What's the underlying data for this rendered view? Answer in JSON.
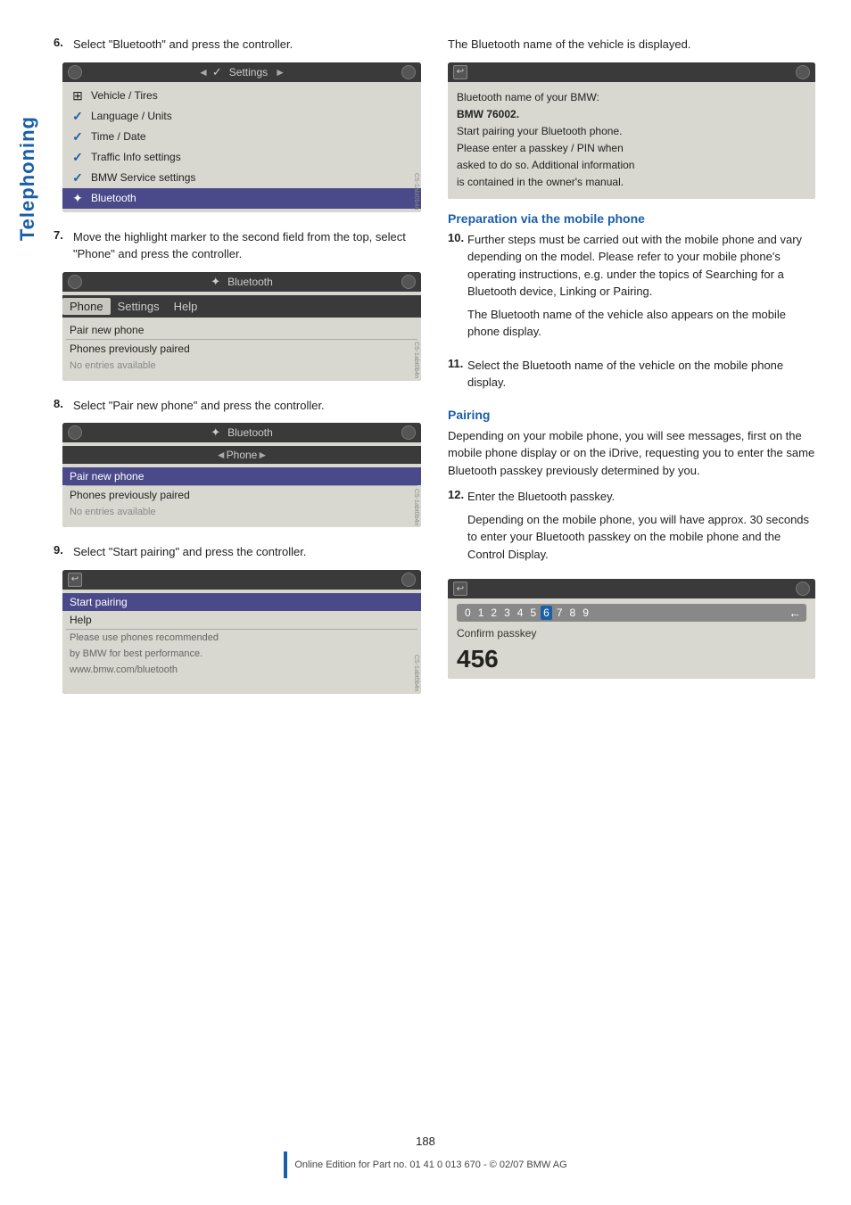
{
  "sideLabel": "Telephoning",
  "steps": {
    "step6": {
      "num": "6.",
      "text": "Select \"Bluetooth\" and press the controller."
    },
    "step7": {
      "num": "7.",
      "text": "Move the highlight marker to the second field from the top, select \"Phone\" and press the controller."
    },
    "step8": {
      "num": "8.",
      "text": "Select \"Pair new phone\" and press the controller."
    },
    "step9": {
      "num": "9.",
      "text": "Select \"Start pairing\" and press the controller."
    },
    "step10": {
      "num": "10.",
      "text": "Further steps must be carried out with the mobile phone and vary depending on the model. Please refer to your mobile phone's operating instructions, e.g. under the topics of Searching for a Bluetooth device, Linking or Pairing.",
      "subtext": "The Bluetooth name of the vehicle also appears on the mobile phone display."
    },
    "step11": {
      "num": "11.",
      "text": "Select the Bluetooth name of the vehicle on the mobile phone display."
    },
    "step12": {
      "num": "12.",
      "text": "Enter the Bluetooth passkey.",
      "subtext": "Depending on the mobile phone, you will have approx. 30 seconds to enter your Bluetooth passkey on the mobile phone and the Control Display."
    }
  },
  "rightIntroText": "The Bluetooth name of the vehicle is displayed.",
  "sections": {
    "preparationTitle": "Preparation via the mobile phone",
    "pairingTitle": "Pairing",
    "pairingText": "Depending on your mobile phone, you will see messages, first on the mobile phone display or on the iDrive, requesting you to enter the same Bluetooth passkey previously determined by you."
  },
  "screens": {
    "settingsMenu": {
      "title": "Settings",
      "items": [
        {
          "icon": "⊞",
          "label": "Vehicle / Tires",
          "selected": false
        },
        {
          "icon": "✓",
          "label": "Language / Units",
          "selected": false
        },
        {
          "icon": "✓",
          "label": "Time / Date",
          "selected": false
        },
        {
          "icon": "✓",
          "label": "Traffic Info settings",
          "selected": false
        },
        {
          "icon": "✓",
          "label": "BMW Service settings",
          "selected": false
        },
        {
          "icon": "✦",
          "label": "Bluetooth",
          "selected": true
        }
      ]
    },
    "bluetoothMenu1": {
      "title": "Bluetooth",
      "tabs": [
        "Phone",
        "Settings",
        "Help"
      ],
      "activeTab": "Phone",
      "items": [
        {
          "label": "Pair new phone",
          "selected": false
        },
        {
          "label": "Phones previously paired",
          "selected": false
        },
        {
          "label": "No entries available",
          "selected": false
        }
      ]
    },
    "bluetoothMenu2": {
      "title": "Bluetooth",
      "subtitle": "Phone",
      "items": [
        {
          "label": "Pair new phone",
          "selected": true
        },
        {
          "label": "Phones previously paired",
          "selected": false
        },
        {
          "label": "No entries available",
          "selected": false
        }
      ]
    },
    "startPairingMenu": {
      "items": [
        {
          "label": "Start pairing",
          "selected": true
        },
        {
          "label": "Help",
          "selected": false
        },
        {
          "label": "Please use phones recommended",
          "selected": false
        },
        {
          "label": "by BMW for best performance.",
          "selected": false
        },
        {
          "label": "www.bmw.com/bluetooth",
          "selected": false
        }
      ]
    },
    "btInfoScreen": {
      "lines": [
        "Bluetooth name of your BMW:",
        "BMW 76002.",
        "Start pairing your Bluetooth phone.",
        "Please enter a passkey / PIN when",
        "asked to do so. Additional information",
        "is contained in the owner's manual."
      ]
    },
    "passkeyScreen": {
      "digits": [
        "0",
        "1",
        "2",
        "3",
        "4",
        "5",
        "6",
        "7",
        "8",
        "9"
      ],
      "activeDigit": "6",
      "confirmLabel": "Confirm passkey",
      "value": "456"
    }
  },
  "footer": {
    "pageNumber": "188",
    "footerText": "Online Edition for Part no. 01 41 0 013 670 - © 02/07 BMW AG"
  }
}
